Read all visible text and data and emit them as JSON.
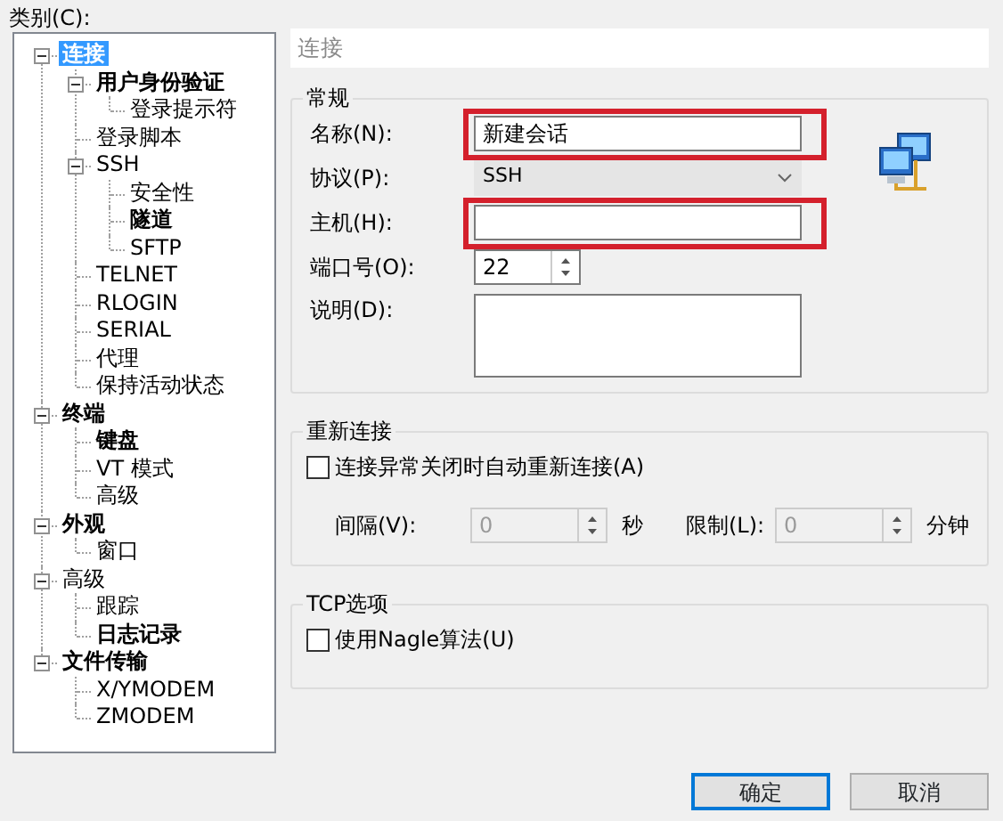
{
  "category_label": "类别(C):",
  "tree": [
    {
      "label": "连接",
      "bold": true,
      "selected": true,
      "expanded": true,
      "children": [
        {
          "label": "用户身份验证",
          "bold": true,
          "selected": false,
          "expanded": true,
          "children": [
            {
              "label": "登录提示符",
              "bold": false,
              "selected": false
            }
          ]
        },
        {
          "label": "登录脚本",
          "bold": false,
          "selected": false
        },
        {
          "label": "SSH",
          "bold": false,
          "selected": false,
          "expanded": true,
          "children": [
            {
              "label": "安全性",
              "bold": false,
              "selected": false
            },
            {
              "label": "隧道",
              "bold": true,
              "selected": false
            },
            {
              "label": "SFTP",
              "bold": false,
              "selected": false
            }
          ]
        },
        {
          "label": "TELNET",
          "bold": false,
          "selected": false
        },
        {
          "label": "RLOGIN",
          "bold": false,
          "selected": false
        },
        {
          "label": "SERIAL",
          "bold": false,
          "selected": false
        },
        {
          "label": "代理",
          "bold": false,
          "selected": false
        },
        {
          "label": "保持活动状态",
          "bold": false,
          "selected": false
        }
      ]
    },
    {
      "label": "终端",
      "bold": true,
      "selected": false,
      "expanded": true,
      "children": [
        {
          "label": "键盘",
          "bold": true,
          "selected": false
        },
        {
          "label": "VT 模式",
          "bold": false,
          "selected": false
        },
        {
          "label": "高级",
          "bold": false,
          "selected": false
        }
      ]
    },
    {
      "label": "外观",
      "bold": true,
      "selected": false,
      "expanded": true,
      "children": [
        {
          "label": "窗口",
          "bold": false,
          "selected": false
        }
      ]
    },
    {
      "label": "高级",
      "bold": false,
      "selected": false,
      "expanded": true,
      "children": [
        {
          "label": "跟踪",
          "bold": false,
          "selected": false
        },
        {
          "label": "日志记录",
          "bold": true,
          "selected": false
        }
      ]
    },
    {
      "label": "文件传输",
      "bold": true,
      "selected": false,
      "expanded": true,
      "children": [
        {
          "label": "X/YMODEM",
          "bold": false,
          "selected": false
        },
        {
          "label": "ZMODEM",
          "bold": false,
          "selected": false
        }
      ]
    }
  ],
  "panel_title": "连接",
  "general": {
    "title": "常规",
    "fields": [
      {
        "kind": "text",
        "label": "名称(N):",
        "value": "新建会话",
        "highlighted": true
      },
      {
        "kind": "select",
        "label": "协议(P):",
        "value": "SSH",
        "highlighted": false
      },
      {
        "kind": "text",
        "label": "主机(H):",
        "highlighted": true
      },
      {
        "kind": "spin",
        "label": "端口号(O):",
        "value": "22",
        "highlighted": false
      },
      {
        "kind": "textarea",
        "label": "说明(D):",
        "highlighted": false
      }
    ]
  },
  "reconnect": {
    "title": "重新连接",
    "checkbox": {
      "label": "连接异常关闭时自动重新连接(A)",
      "checked": false
    },
    "spins": [
      {
        "label": "间隔(V):",
        "value": "0",
        "unit": "秒",
        "disabled": true
      },
      {
        "label": "限制(L):",
        "value": "0",
        "unit": "分钟",
        "disabled": true
      }
    ]
  },
  "tcp": {
    "title": "TCP选项",
    "checkbox": {
      "label": "使用Nagle算法(U)",
      "checked": false
    }
  },
  "buttons": [
    {
      "label": "确定",
      "default": true
    },
    {
      "label": "取消",
      "default": false
    }
  ]
}
